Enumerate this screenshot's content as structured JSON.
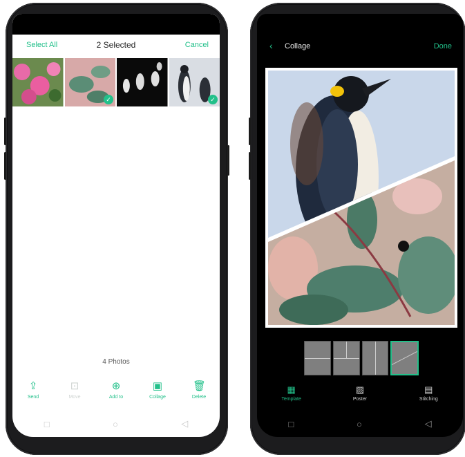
{
  "left": {
    "header": {
      "select_all": "Select All",
      "title": "2 Selected",
      "cancel": "Cancel"
    },
    "photos_count": "4 Photos",
    "toolbar": [
      {
        "label": "Send",
        "icon": "share-icon",
        "glyph": "⇪",
        "enabled": true
      },
      {
        "label": "Move",
        "icon": "move-icon",
        "glyph": "⊡",
        "enabled": false
      },
      {
        "label": "Add to",
        "icon": "add-icon",
        "glyph": "⊕",
        "enabled": true
      },
      {
        "label": "Collage",
        "icon": "collage-icon",
        "glyph": "▣",
        "enabled": true
      },
      {
        "label": "Delete",
        "icon": "trash-icon",
        "glyph": "🗑",
        "enabled": true
      }
    ],
    "thumbnails": [
      {
        "name": "flowers",
        "selected": false
      },
      {
        "name": "leaves",
        "selected": true
      },
      {
        "name": "penguin-group",
        "selected": false
      },
      {
        "name": "penguins",
        "selected": true
      }
    ]
  },
  "right": {
    "header": {
      "back_icon": "back-chevron-icon",
      "title": "Collage",
      "done": "Done"
    },
    "tabs": [
      {
        "label": "Template",
        "icon": "grid-icon",
        "glyph": "▦",
        "active": true
      },
      {
        "label": "Poster",
        "icon": "poster-icon",
        "glyph": "▨",
        "active": false
      },
      {
        "label": "Stitching",
        "icon": "stitch-icon",
        "glyph": "▤",
        "active": false
      }
    ],
    "templates": [
      "template-1",
      "template-2",
      "template-3",
      "template-4"
    ]
  },
  "colors": {
    "accent": "#22c08a",
    "dark": "#000000"
  }
}
